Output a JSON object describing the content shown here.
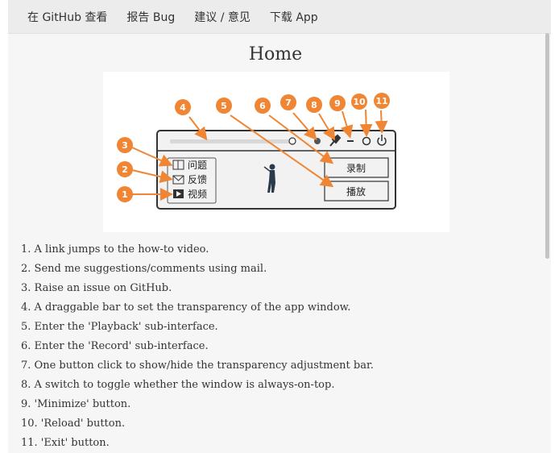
{
  "nav": {
    "github": "在 GitHub 查看",
    "bug": "报告 Bug",
    "suggest": "建议 / 意见",
    "download": "下载 App"
  },
  "page": {
    "title": "Home"
  },
  "diagram": {
    "numbers": [
      "1",
      "2",
      "3",
      "4",
      "5",
      "6",
      "7",
      "8",
      "9",
      "10",
      "11"
    ],
    "menu": {
      "issue": "问题",
      "feedback": "反馈",
      "video": "视频"
    },
    "buttons": {
      "record": "录制",
      "play": "播放"
    },
    "accent_color": "#f08633"
  },
  "descriptions": [
    "1. A link jumps to the how-to video.",
    "2. Send me suggestions/comments using mail.",
    "3. Raise an issue on GitHub.",
    "4. A draggable bar to set the transparency of the app window.",
    "5. Enter the 'Playback' sub-interface.",
    "6. Enter the 'Record' sub-interface.",
    "7. One button click to show/hide the transparency adjustment bar.",
    "8. A switch to toggle whether the window is always-on-top.",
    "9. 'Minimize' button.",
    "10. 'Reload' button.",
    "11. 'Exit' button."
  ]
}
